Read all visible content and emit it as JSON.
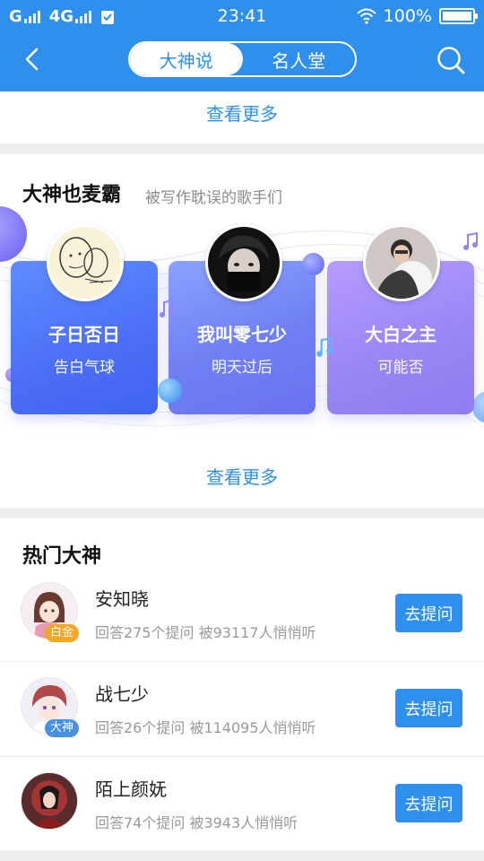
{
  "status": {
    "carrier1": "G",
    "carrier2": "4G",
    "time": "23:41",
    "battery": "100%",
    "battery_level": 1.0
  },
  "header": {
    "tabs": [
      {
        "label": "大神说",
        "active": true
      },
      {
        "label": "名人堂",
        "active": false
      }
    ],
    "accent_color": "#2f8fec"
  },
  "top_card": {
    "see_more": "查看更多"
  },
  "singers_section": {
    "title": "大神也麦霸",
    "subtitle": "被写作耽误的歌手们",
    "see_more": "查看更多",
    "cards": [
      {
        "name": "子日否日",
        "song": "告白气球"
      },
      {
        "name": "我叫零七少",
        "song": "明天过后"
      },
      {
        "name": "大白之主",
        "song": "可能否"
      }
    ]
  },
  "hot_section": {
    "title": "热门大神",
    "ask_label": "去提问",
    "rows": [
      {
        "name": "安知晓",
        "stats": "回答275个提问 被93117人悄悄听",
        "badge": "白金",
        "badge_color": "#f5a623"
      },
      {
        "name": "战七少",
        "stats": "回答26个提问 被114095人悄悄听",
        "badge": "大神",
        "badge_color": "#4a90e2"
      },
      {
        "name": "陌上颜妩",
        "stats": "回答74个提问 被3943人悄悄听",
        "badge": "",
        "badge_color": ""
      }
    ]
  }
}
